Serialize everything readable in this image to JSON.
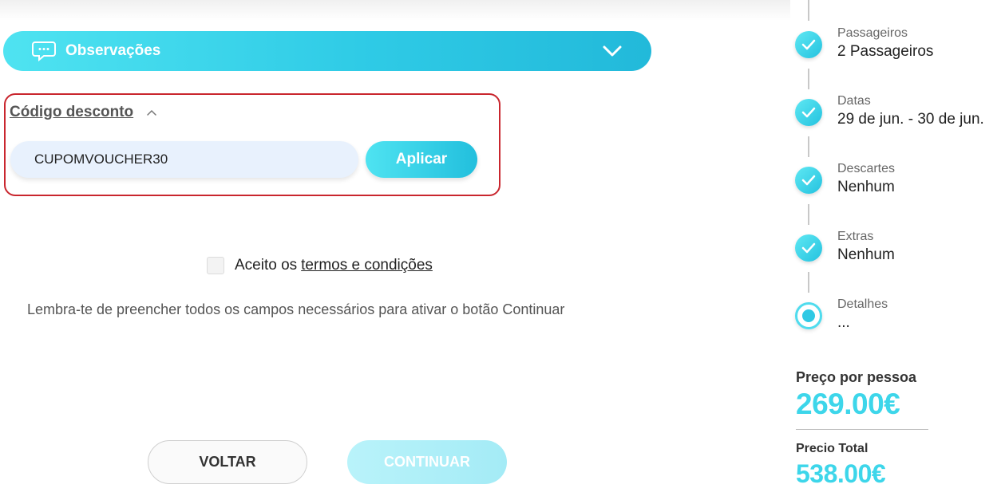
{
  "observations": {
    "label": "Observações"
  },
  "discount": {
    "title": "Código desconto",
    "code_value": "CUPOMVOUCHER30",
    "apply_label": "Aplicar"
  },
  "terms": {
    "prefix": "Aceito os",
    "link": "termos e condições",
    "checked": false
  },
  "reminder": "Lembra-te de preencher todos os campos necessários para ativar o botão Continuar",
  "buttons": {
    "back": "VOLTAR",
    "continue": "CONTINUAR"
  },
  "steps": [
    {
      "label": "Passageiros",
      "value": "2 Passageiros",
      "status": "done"
    },
    {
      "label": "Datas",
      "value": "29 de jun. - 30 de jun.",
      "status": "done"
    },
    {
      "label": "Descartes",
      "value": "Nenhum",
      "status": "done"
    },
    {
      "label": "Extras",
      "value": "Nenhum",
      "status": "done"
    },
    {
      "label": "Detalhes",
      "value": "...",
      "status": "current"
    }
  ],
  "pricing": {
    "per_person_label": "Preço por pessoa",
    "per_person_value": "269.00€",
    "total_label": "Precio Total",
    "total_value": "538.00€"
  },
  "colors": {
    "accent": "#2fc9e4",
    "accent_light": "#4fe3f1",
    "error_border": "#c9262e"
  }
}
